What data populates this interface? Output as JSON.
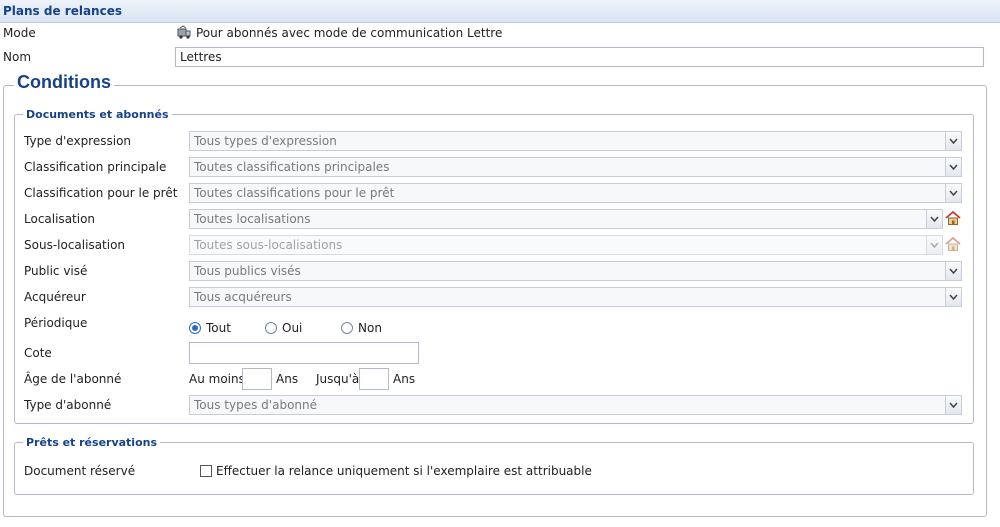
{
  "header": {
    "title": "Plans de relances"
  },
  "mode": {
    "label": "Mode",
    "value": "Pour abonnés avec mode de communication Lettre",
    "icon": "mail-truck-icon"
  },
  "nom": {
    "label": "Nom",
    "value": "Lettres"
  },
  "conditions": {
    "legend": "Conditions",
    "documents": {
      "legend": "Documents et abonnés",
      "type_expression": {
        "label": "Type d'expression",
        "value": "Tous types d'expression"
      },
      "classification_principale": {
        "label": "Classification principale",
        "value": "Toutes classifications principales"
      },
      "classification_pret": {
        "label": "Classification pour le prêt",
        "value": "Toutes classifications pour le prêt"
      },
      "localisation": {
        "label": "Localisation",
        "value": "Toutes localisations"
      },
      "sous_localisation": {
        "label": "Sous-localisation",
        "value": "Toutes sous-localisations"
      },
      "public_vise": {
        "label": "Public visé",
        "value": "Tous publics visés"
      },
      "acquereur": {
        "label": "Acquéreur",
        "value": "Tous acquéreurs"
      },
      "periodique": {
        "label": "Périodique",
        "options": [
          "Tout",
          "Oui",
          "Non"
        ],
        "selected": "Tout"
      },
      "cote": {
        "label": "Cote",
        "value": ""
      },
      "age": {
        "label": "Âge de l'abonné",
        "min_label": "Au moins",
        "max_label": "Jusqu'à",
        "unit": "Ans",
        "min_value": "",
        "max_value": ""
      },
      "type_abonne": {
        "label": "Type d'abonné",
        "value": "Tous types d'abonné"
      }
    },
    "prets": {
      "legend": "Prêts et réservations",
      "document_reserve": {
        "label": "Document réservé",
        "checkbox_label": "Effectuer la relance uniquement si l'exemplaire est attribuable",
        "checked": false
      }
    }
  },
  "colors": {
    "accent": "#15428b",
    "border": "#b5b8c8",
    "radio_selected": "#2a6ac7"
  }
}
